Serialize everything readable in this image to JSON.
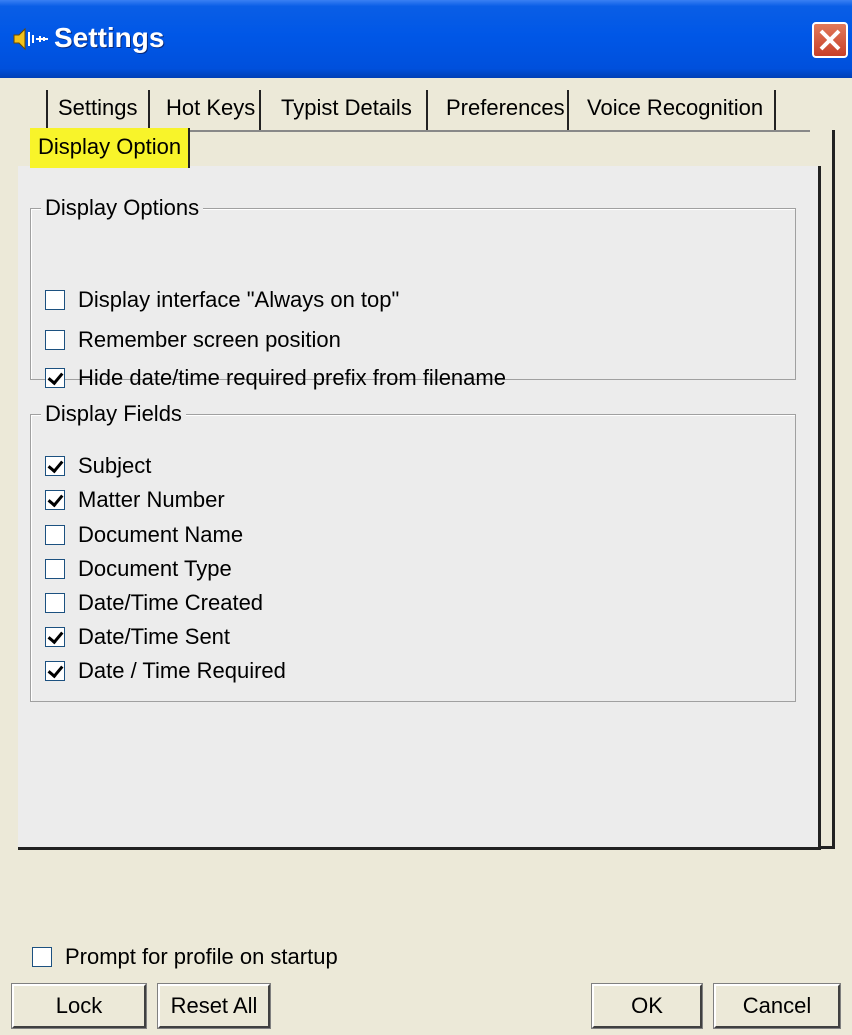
{
  "window": {
    "title": "Settings",
    "icon": "speaker-waveform-icon",
    "close_icon": "close-icon"
  },
  "tabs": {
    "row1": [
      "Settings",
      "Hot Keys",
      "Typist Details",
      "Preferences",
      "Voice Recognition"
    ],
    "active": "Display Option",
    "active_color": "#f8f42a"
  },
  "display_options": {
    "title": "Display Options",
    "items": [
      {
        "label": "Display interface \"Always on top\"",
        "checked": false
      },
      {
        "label": "Remember screen position",
        "checked": false
      },
      {
        "label": "Hide date/time required prefix from filename",
        "checked": true
      }
    ]
  },
  "display_fields": {
    "title": "Display Fields",
    "items": [
      {
        "label": "Subject",
        "checked": true
      },
      {
        "label": "Matter Number",
        "checked": true
      },
      {
        "label": "Document Name",
        "checked": false
      },
      {
        "label": "Document Type",
        "checked": false
      },
      {
        "label": "Date/Time Created",
        "checked": false
      },
      {
        "label": "Date/Time Sent",
        "checked": true
      },
      {
        "label": "Date / Time Required",
        "checked": true
      }
    ]
  },
  "footer": {
    "prompt_label": "Prompt for profile on startup",
    "prompt_checked": false,
    "lock_label": "Lock",
    "reset_label": "Reset All",
    "ok_label": "OK",
    "cancel_label": "Cancel"
  }
}
